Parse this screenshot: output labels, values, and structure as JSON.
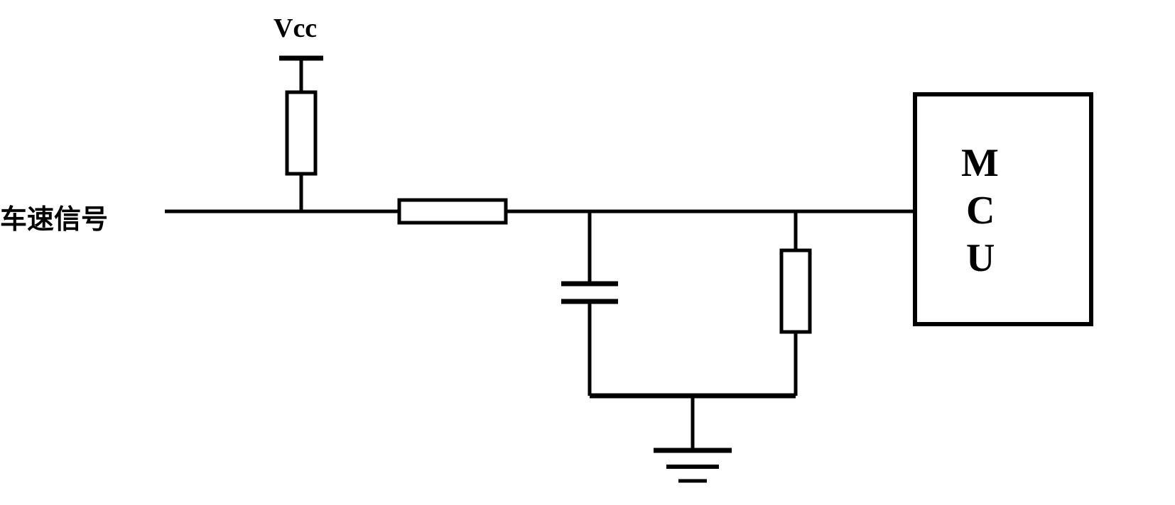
{
  "labels": {
    "vcc": "Vcc",
    "speed_signal": "车速信号",
    "mcu_line1": "M",
    "mcu_line2": "C",
    "mcu_line3": "U"
  },
  "circuit": {
    "type": "signal_conditioning",
    "input": "vehicle_speed_signal",
    "output": "MCU",
    "components": [
      "pull_up_resistor",
      "series_resistor",
      "filter_capacitor",
      "pull_down_resistor",
      "ground"
    ]
  }
}
